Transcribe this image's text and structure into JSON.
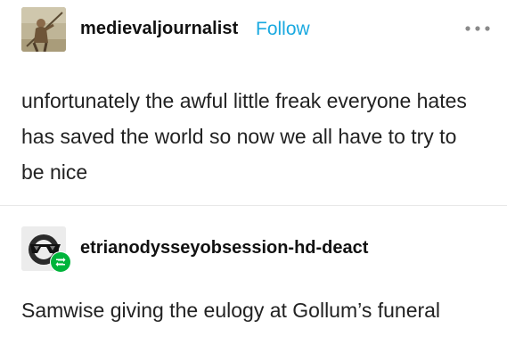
{
  "post": {
    "author": {
      "username": "medievaljournalist",
      "follow_label": "Follow",
      "avatar_icon": "medieval-figure-avatar"
    },
    "more_icon": "ellipsis-icon",
    "body": "unfortunately the awful little freak everyone hates has saved the world so now we all have to try to be nice"
  },
  "reblog": {
    "author": {
      "username": "etrianodysseyobsession-hd-deact",
      "avatar_icon": "sunglasses-face-avatar",
      "badge_icon": "reblog-icon"
    },
    "body": "Samwise giving the eulogy at Gollum’s funeral"
  },
  "colors": {
    "follow": "#1aa9e0",
    "reblog_badge": "#00b43b",
    "text": "#222222",
    "divider": "#e8e8e8"
  }
}
